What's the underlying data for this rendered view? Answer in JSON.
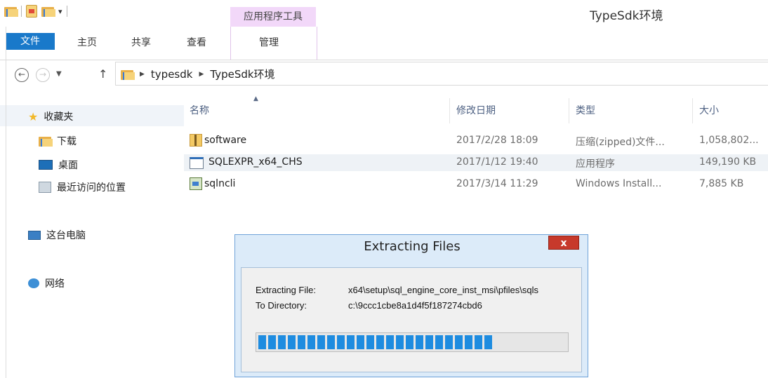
{
  "window": {
    "title": "TypeSdk环境",
    "context_tab_group": "应用程序工具"
  },
  "ribbon": {
    "tabs": [
      "文件",
      "主页",
      "共享",
      "查看",
      "管理"
    ]
  },
  "address_bar": {
    "crumbs": [
      "typesdk",
      "TypeSdk环境"
    ]
  },
  "nav_pane": {
    "favorites": "收藏夹",
    "downloads": "下载",
    "desktop": "桌面",
    "recent": "最近访问的位置",
    "this_pc": "这台电脑",
    "network": "网络"
  },
  "file_list": {
    "headers": {
      "name": "名称",
      "modified": "修改日期",
      "type": "类型",
      "size": "大小"
    },
    "rows": [
      {
        "name": "software",
        "modified": "2017/2/28 18:09",
        "type": "压缩(zipped)文件...",
        "size": "1,058,802..."
      },
      {
        "name": "SQLEXPR_x64_CHS",
        "modified": "2017/1/12 19:40",
        "type": "应用程序",
        "size": "149,190 KB"
      },
      {
        "name": "sqlncli",
        "modified": "2017/3/14 11:29",
        "type": "Windows Install...",
        "size": "7,885 KB"
      }
    ]
  },
  "dialog": {
    "title": "Extracting Files",
    "close": "x",
    "file_label": "Extracting File:",
    "file_value": "x64\\setup\\sql_engine_core_inst_msi\\pfiles\\sqls",
    "dir_label": "To Directory:",
    "dir_value": "c:\\9ccc1cbe8a1d4f5f187274cbd6",
    "progress_fraction": 0.78
  },
  "colors": {
    "file_tab": "#1979ca",
    "context_tab": "#f2d8f9",
    "progress": "#1e8ce0",
    "selected_row": "#e5f3fb"
  }
}
